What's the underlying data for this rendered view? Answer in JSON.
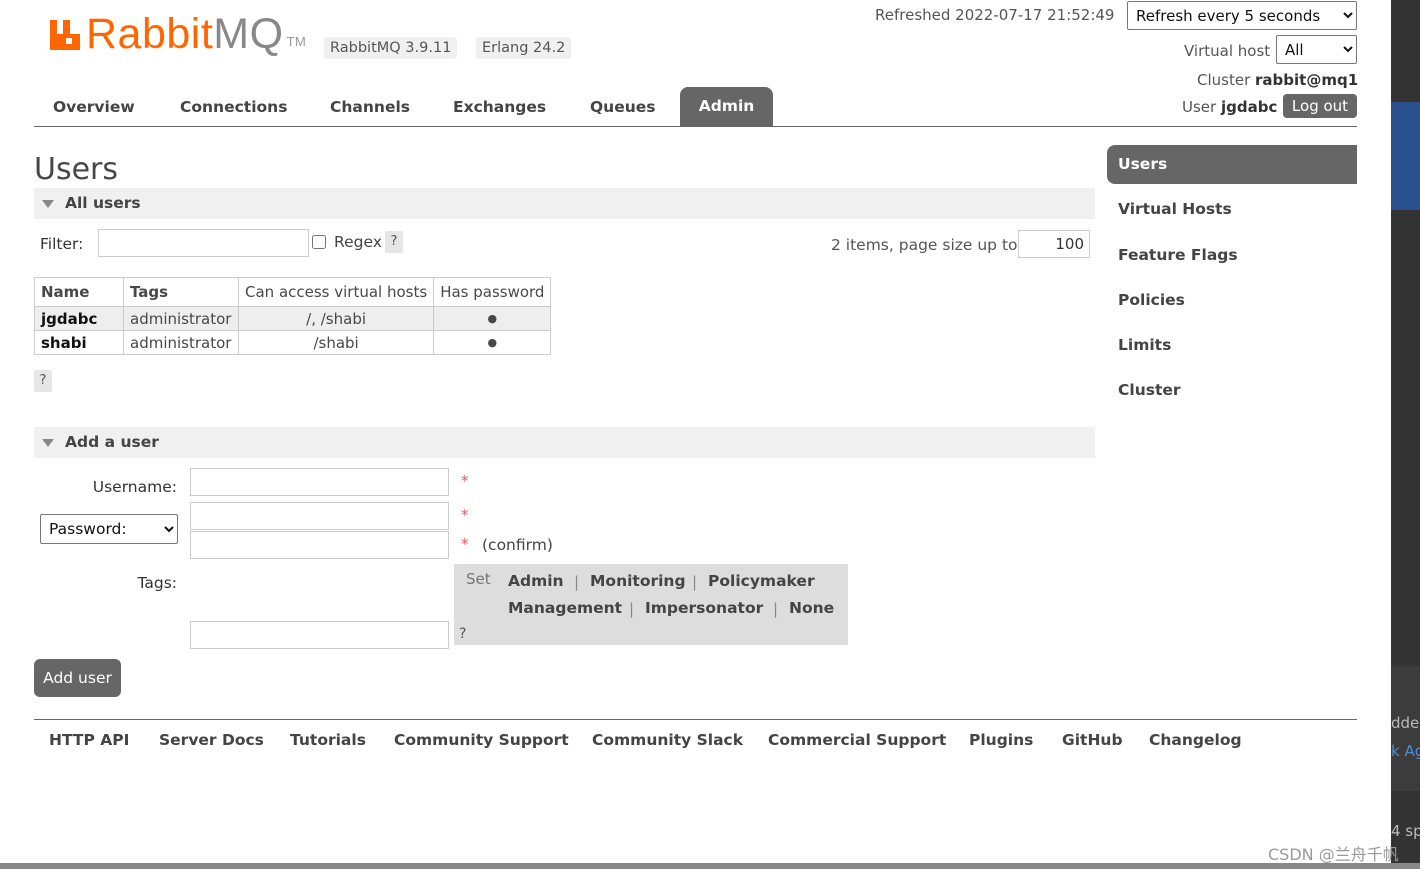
{
  "brand": {
    "name_main": "Rabbit",
    "name_mq": "MQ",
    "tm": "TM",
    "colors": {
      "orange": "#ff6600",
      "gray": "#666666"
    }
  },
  "versions": {
    "rabbitmq": "RabbitMQ 3.9.11",
    "erlang": "Erlang 24.2"
  },
  "header": {
    "refreshed_label": "Refreshed 2022-07-17 21:52:49",
    "refresh_select": "Refresh every 5 seconds",
    "vhost_label": "Virtual host",
    "vhost_select": "All",
    "cluster_label": "Cluster",
    "cluster_name": "rabbit@mq1",
    "user_label": "User",
    "user_name": "jgdabc",
    "logout": "Log out"
  },
  "tabs": [
    "Overview",
    "Connections",
    "Channels",
    "Exchanges",
    "Queues",
    "Admin"
  ],
  "active_tab": "Admin",
  "page_title": "Users",
  "all_users": {
    "section_label": "All users",
    "filter_label": "Filter:",
    "filter_value": "",
    "regex_label": "Regex",
    "help": "?",
    "items_label": "2 items, page size up to",
    "page_size": "100",
    "columns": [
      "Name",
      "Tags",
      "Can access virtual hosts",
      "Has password"
    ],
    "rows": [
      {
        "name": "jgdabc",
        "tags": "administrator",
        "vhosts": "/, /shabi",
        "has_password": "●"
      },
      {
        "name": "shabi",
        "tags": "administrator",
        "vhosts": "/shabi",
        "has_password": "●"
      }
    ]
  },
  "side_nav": [
    "Users",
    "Virtual Hosts",
    "Feature Flags",
    "Policies",
    "Limits",
    "Cluster"
  ],
  "side_active": "Users",
  "add_user": {
    "section_label": "Add a user",
    "username_label": "Username:",
    "password_select": "Password:",
    "required": "*",
    "confirm_label": "(confirm)",
    "tags_label": "Tags:",
    "set_label": "Set",
    "tag_options": [
      "Admin",
      "Monitoring",
      "Policymaker",
      "Management",
      "Impersonator",
      "None"
    ],
    "separator": "|",
    "help": "?",
    "button": "Add user"
  },
  "footer": [
    "HTTP API",
    "Server Docs",
    "Tutorials",
    "Community Support",
    "Community Slack",
    "Commercial Support",
    "Plugins",
    "GitHub",
    "Changelog"
  ],
  "edge_text": [
    "dde",
    "k Ag",
    "4 sp"
  ],
  "watermark": "CSDN @兰舟千帆"
}
